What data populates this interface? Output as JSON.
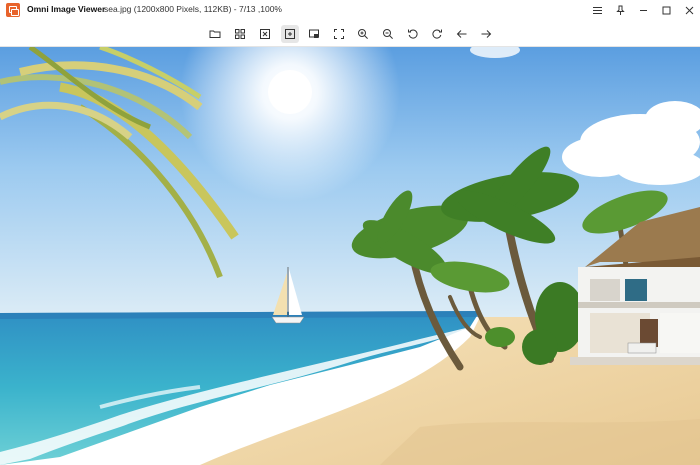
{
  "window": {
    "app_name": "Omni Image Viewer",
    "file_info": "sea.jpg (1200x800 Pixels, 112KB)  -  7/13 ,100%",
    "icon": "app-logo-icon"
  },
  "window_controls": [
    {
      "name": "menu-icon"
    },
    {
      "name": "pin-icon"
    },
    {
      "name": "minimize-icon"
    },
    {
      "name": "maximize-icon"
    },
    {
      "name": "close-icon"
    }
  ],
  "toolbar": [
    {
      "name": "open-folder-button",
      "icon": "folder-icon"
    },
    {
      "name": "thumbnails-button",
      "icon": "grid-icon"
    },
    {
      "name": "fit-to-window-button",
      "icon": "fit-icon"
    },
    {
      "name": "actual-size-button",
      "icon": "actual-size-icon",
      "active": true
    },
    {
      "name": "slideshow-button",
      "icon": "slideshow-icon"
    },
    {
      "name": "fullscreen-button",
      "icon": "fullscreen-icon"
    },
    {
      "name": "zoom-in-button",
      "icon": "zoom-in-icon"
    },
    {
      "name": "zoom-out-button",
      "icon": "zoom-out-icon"
    },
    {
      "name": "rotate-left-button",
      "icon": "rotate-left-icon"
    },
    {
      "name": "rotate-right-button",
      "icon": "rotate-right-icon"
    },
    {
      "name": "previous-image-button",
      "icon": "arrow-left-icon"
    },
    {
      "name": "next-image-button",
      "icon": "arrow-right-icon"
    }
  ],
  "image": {
    "description_colors": {
      "sky_top": "#4a8fd6",
      "sky_bottom": "#cfe4f4",
      "sea": "#2aa3c2",
      "sand": "#f0dcb0",
      "palm": "#3f7a2a"
    }
  }
}
